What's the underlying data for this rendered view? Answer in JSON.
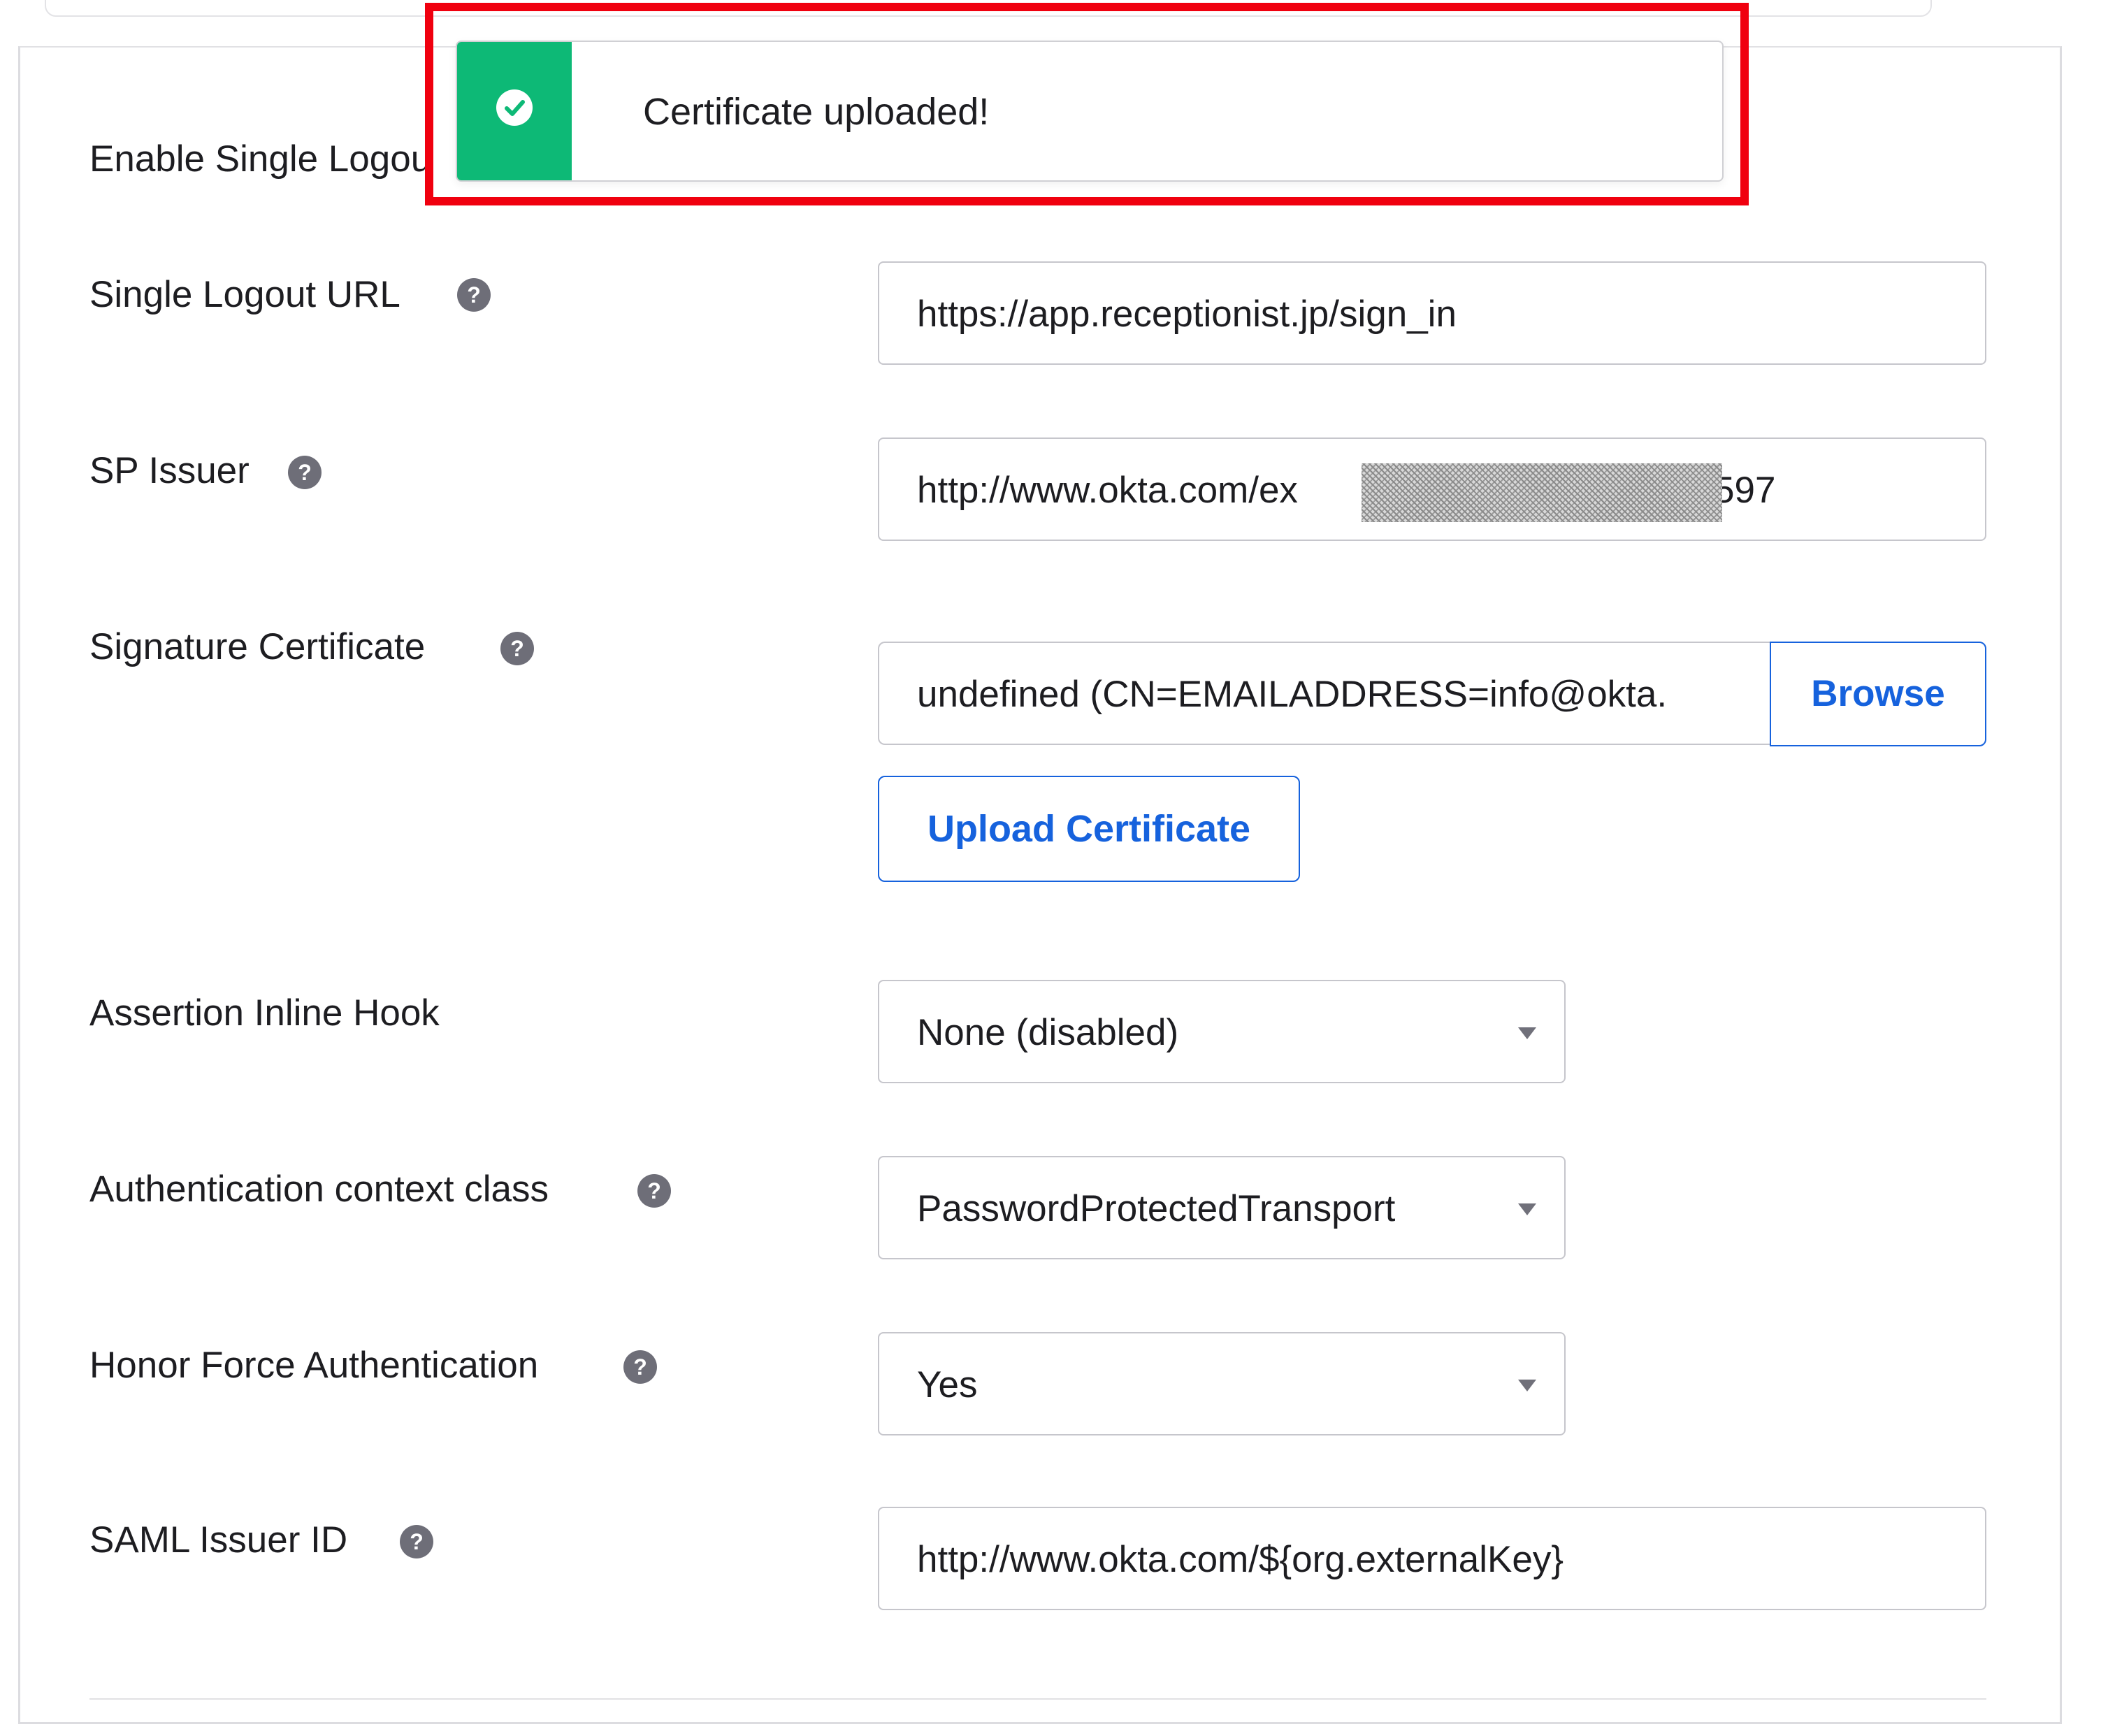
{
  "toast": {
    "message": "Certificate uploaded!",
    "icon": "check-circle-icon",
    "accent_color": "#0db976"
  },
  "highlight_color": "#f0000f",
  "form": {
    "enable_single_logout": {
      "label": "Enable Single Logou"
    },
    "single_logout_url": {
      "label": "Single Logout URL",
      "value": "https://app.receptionist.jp/sign_in"
    },
    "sp_issuer": {
      "label": "SP Issuer",
      "value_prefix": "http://www.okta.com/ex",
      "value_suffix": "597"
    },
    "signature_certificate": {
      "label": "Signature Certificate",
      "value": "undefined (CN=EMAILADDRESS=info@okta.",
      "browse_label": "Browse",
      "upload_label": "Upload Certificate"
    },
    "assertion_inline_hook": {
      "label": "Assertion Inline Hook",
      "selected": "None (disabled)"
    },
    "authentication_context_class": {
      "label": "Authentication context class",
      "selected": "PasswordProtectedTransport"
    },
    "honor_force_authentication": {
      "label": "Honor Force Authentication",
      "selected": "Yes"
    },
    "saml_issuer_id": {
      "label": "SAML Issuer ID",
      "value": "http://www.okta.com/${org.externalKey}"
    }
  },
  "help_icon": {
    "glyph": "?"
  },
  "link_color": "#1662dd"
}
